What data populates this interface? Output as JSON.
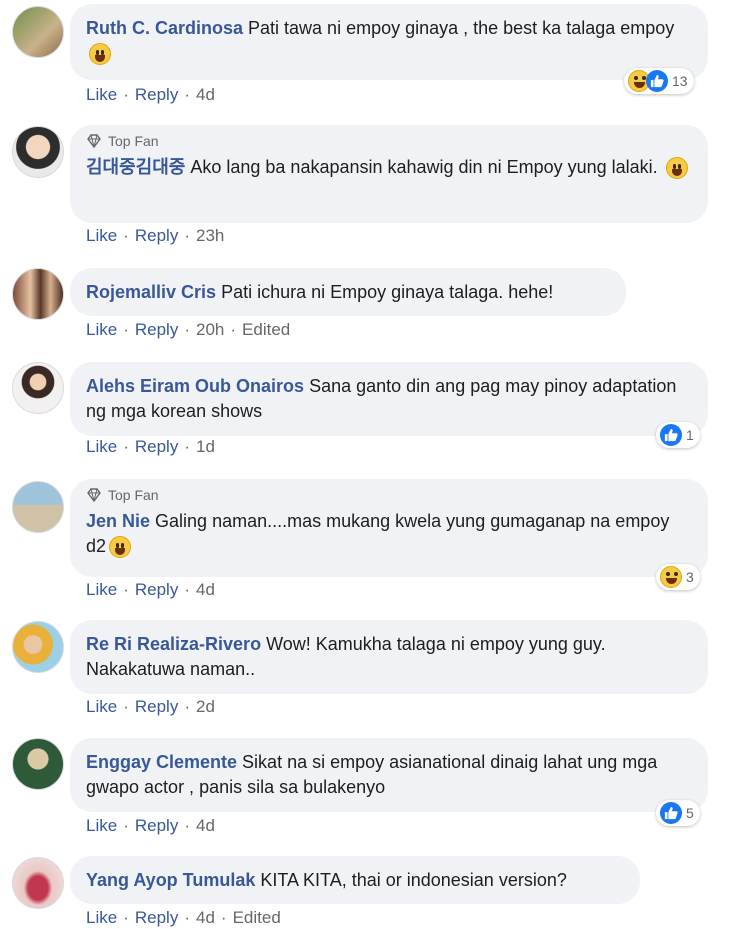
{
  "actions": {
    "like": "Like",
    "reply": "Reply",
    "edited": "Edited",
    "dot": "·"
  },
  "top_fan_label": "Top Fan",
  "comments": [
    {
      "author": "Ruth C. Cardinosa",
      "text": "Pati tawa ni empoy ginaya , the best ka talaga empoy",
      "time": "4d",
      "reaction_count": "13",
      "emoji": "grinning-face"
    },
    {
      "author": "김대중김대중",
      "text": "Ako lang ba nakapansin kahawig din ni Empoy yung lalaki.",
      "time": "23h",
      "top_fan": true,
      "emoji": "tears-of-joy-face"
    },
    {
      "author": "Rojemalliv Cris",
      "text": "Pati ichura ni Empoy ginaya talaga. hehe!",
      "time": "20h",
      "edited": true
    },
    {
      "author": "Alehs Eiram Oub Onairos",
      "text": "Sana ganto din ang pag may pinoy adaptation ng mga korean shows",
      "time": "1d",
      "reaction_count": "1"
    },
    {
      "author": "Jen Nie",
      "text": "Galing naman....mas mukang kwela yung gumaganap na empoy d2",
      "time": "4d",
      "top_fan": true,
      "reaction_count": "3",
      "emoji": "sweat-smile-face"
    },
    {
      "author": "Re Ri Realiza-Rivero",
      "text": "Wow! Kamukha talaga ni empoy yung guy. Nakakatuwa naman..",
      "time": "2d"
    },
    {
      "author": "Enggay Clemente",
      "text": "Sikat na si empoy asianational dinaig lahat ung mga gwapo actor , panis sila sa bulakenyo",
      "time": "4d",
      "reaction_count": "5"
    },
    {
      "author": "Yang Ayop Tumulak",
      "text": "KITA KITA, thai or indonesian version?",
      "time": "4d",
      "edited": true
    }
  ],
  "colors": {
    "author": "#385898",
    "bubble": "#f0f2f5",
    "meta": "#65676b",
    "like_blue": "#1877f2",
    "haha_yellow": "#f7c948"
  }
}
